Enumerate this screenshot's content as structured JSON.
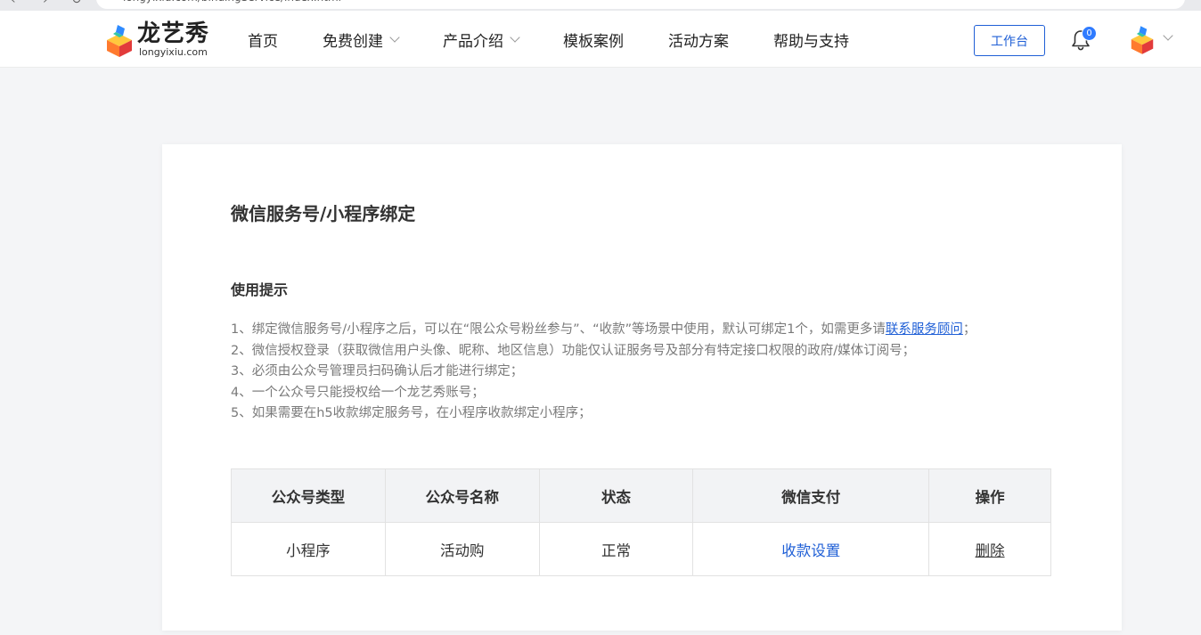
{
  "browser": {
    "url": "longyixiu.com/bindingService/index.html"
  },
  "header": {
    "logo_text": "龙艺秀",
    "logo_sub": "longyixiu.com",
    "nav": [
      {
        "label": "首页",
        "has_dropdown": false
      },
      {
        "label": "免费创建",
        "has_dropdown": true
      },
      {
        "label": "产品介绍",
        "has_dropdown": true
      },
      {
        "label": "模板案例",
        "has_dropdown": false
      },
      {
        "label": "活动方案",
        "has_dropdown": false
      },
      {
        "label": "帮助与支持",
        "has_dropdown": false
      }
    ],
    "workbench_label": "工作台",
    "notification_count": "0"
  },
  "card": {
    "title": "微信服务号/小程序绑定",
    "tips_title": "使用提示",
    "tips": [
      {
        "before": "1、绑定微信服务号/小程序之后，可以在“限公众号粉丝参与”、“收款”等场景中使用，默认可绑定1个，如需更多请",
        "link": "联系服务顾问",
        "after": "；"
      },
      {
        "text": "2、微信授权登录（获取微信用户头像、昵称、地区信息）功能仅认证服务号及部分有特定接口权限的政府/媒体订阅号；"
      },
      {
        "text": "3、必须由公众号管理员扫码确认后才能进行绑定；"
      },
      {
        "text": "4、一个公众号只能授权给一个龙艺秀账号；"
      },
      {
        "text": "5、如果需要在h5收款绑定服务号，在小程序收款绑定小程序；"
      }
    ],
    "table": {
      "headers": [
        "公众号类型",
        "公众号名称",
        "状态",
        "微信支付",
        "操作"
      ],
      "rows": [
        {
          "type": "小程序",
          "name": "活动购",
          "status": "正常",
          "payment": "收款设置",
          "action": "删除"
        }
      ]
    }
  },
  "colors": {
    "accent": "#1f5fd6",
    "badge": "#2f7bff",
    "table_header_bg": "#f2f3f5"
  }
}
